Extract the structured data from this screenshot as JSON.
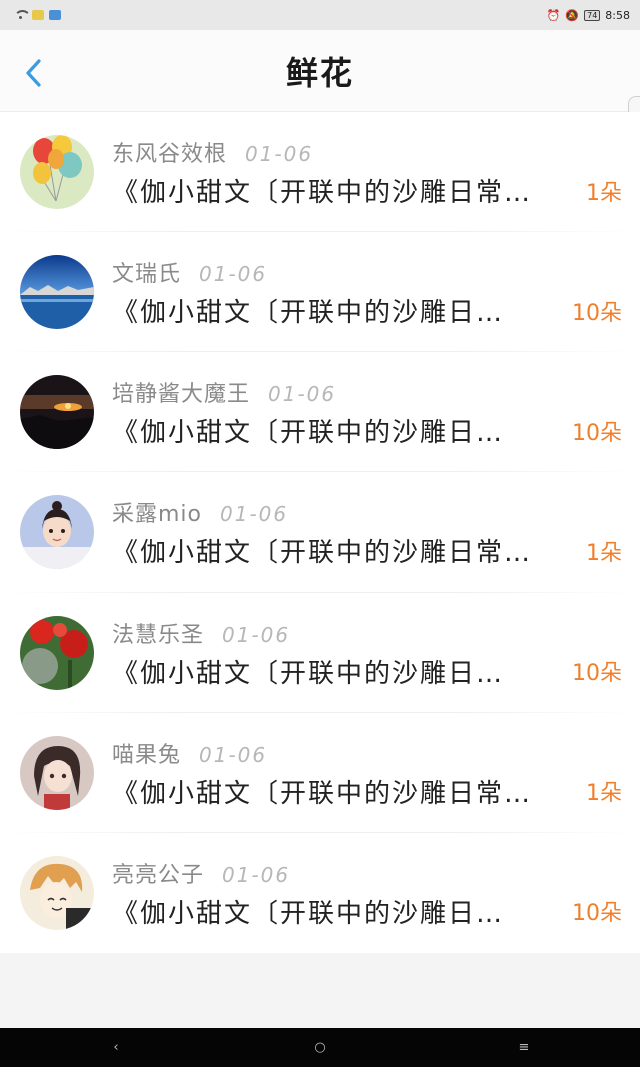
{
  "status_bar": {
    "time": "8:58",
    "battery": "74",
    "icons": [
      "wifi-icon",
      "app-notification-icon",
      "app-notification-icon",
      "alarm-icon",
      "mute-icon",
      "battery-icon"
    ]
  },
  "header": {
    "title": "鲜花",
    "back_icon": "chevron-left-icon"
  },
  "items": [
    {
      "name": "东风谷效根",
      "date": "01-06",
      "text": "《伽小甜文〔开联中的沙雕日常",
      "count": "1朵",
      "avatar": "balloons"
    },
    {
      "name": "文瑞氏",
      "date": "01-06",
      "text": "《伽小甜文〔开联中的沙雕日",
      "count": "10朵",
      "avatar": "lake"
    },
    {
      "name": "培静酱大魔王",
      "date": "01-06",
      "text": "《伽小甜文〔开联中的沙雕日",
      "count": "10朵",
      "avatar": "sunset"
    },
    {
      "name": "采露mio",
      "date": "01-06",
      "text": "《伽小甜文〔开联中的沙雕日常",
      "count": "1朵",
      "avatar": "girl"
    },
    {
      "name": "法慧乐圣",
      "date": "01-06",
      "text": "《伽小甜文〔开联中的沙雕日",
      "count": "10朵",
      "avatar": "flowers"
    },
    {
      "name": "喵果兔",
      "date": "01-06",
      "text": "《伽小甜文〔开联中的沙雕日常",
      "count": "1朵",
      "avatar": "anime-girl"
    },
    {
      "name": "亮亮公子",
      "date": "01-06",
      "text": "《伽小甜文〔开联中的沙雕日",
      "count": "10朵",
      "avatar": "anime-boy"
    }
  ],
  "nav_bar": {
    "back": "‹",
    "home": "○",
    "menu": "≡"
  },
  "colors": {
    "accent": "#3a9be0",
    "count": "#f07f2b",
    "username": "#8a8a8a",
    "date": "#b7b7b7"
  }
}
